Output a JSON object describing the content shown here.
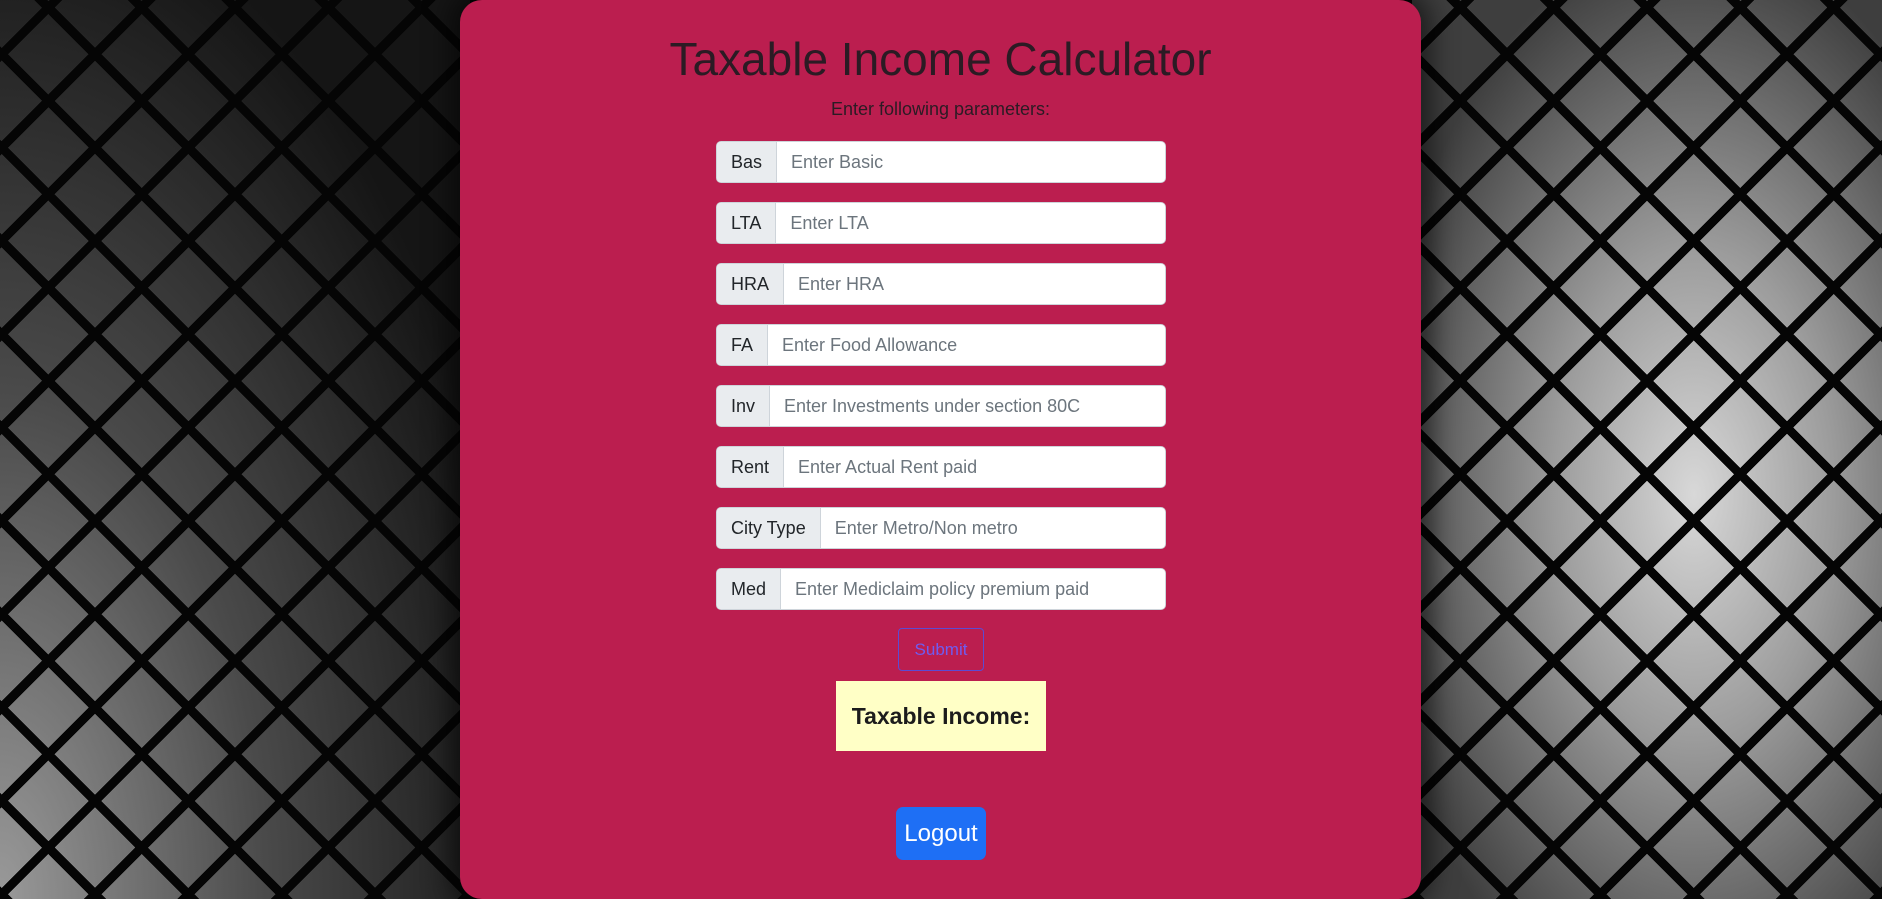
{
  "page": {
    "title": "Taxable Income Calculator",
    "subtitle": "Enter following parameters:"
  },
  "form": {
    "fields": [
      {
        "label": "Bas",
        "placeholder": "Enter Basic",
        "value": ""
      },
      {
        "label": "LTA",
        "placeholder": "Enter LTA",
        "value": ""
      },
      {
        "label": "HRA",
        "placeholder": "Enter HRA",
        "value": ""
      },
      {
        "label": "FA",
        "placeholder": "Enter Food Allowance",
        "value": ""
      },
      {
        "label": "Inv",
        "placeholder": "Enter Investments under section 80C",
        "value": ""
      },
      {
        "label": "Rent",
        "placeholder": "Enter Actual Rent paid",
        "value": ""
      },
      {
        "label": "City Type",
        "placeholder": "Enter Metro/Non metro",
        "value": ""
      },
      {
        "label": "Med",
        "placeholder": "Enter Mediclaim policy premium paid",
        "value": ""
      }
    ],
    "submit_label": "Submit"
  },
  "result": {
    "label": "Taxable Income:"
  },
  "logout_label": "Logout",
  "colors": {
    "card_background": "#bb1e4f",
    "result_background": "#ffffc6",
    "logout_button": "#1e6ff5",
    "submit_border": "#5b4bd4"
  }
}
